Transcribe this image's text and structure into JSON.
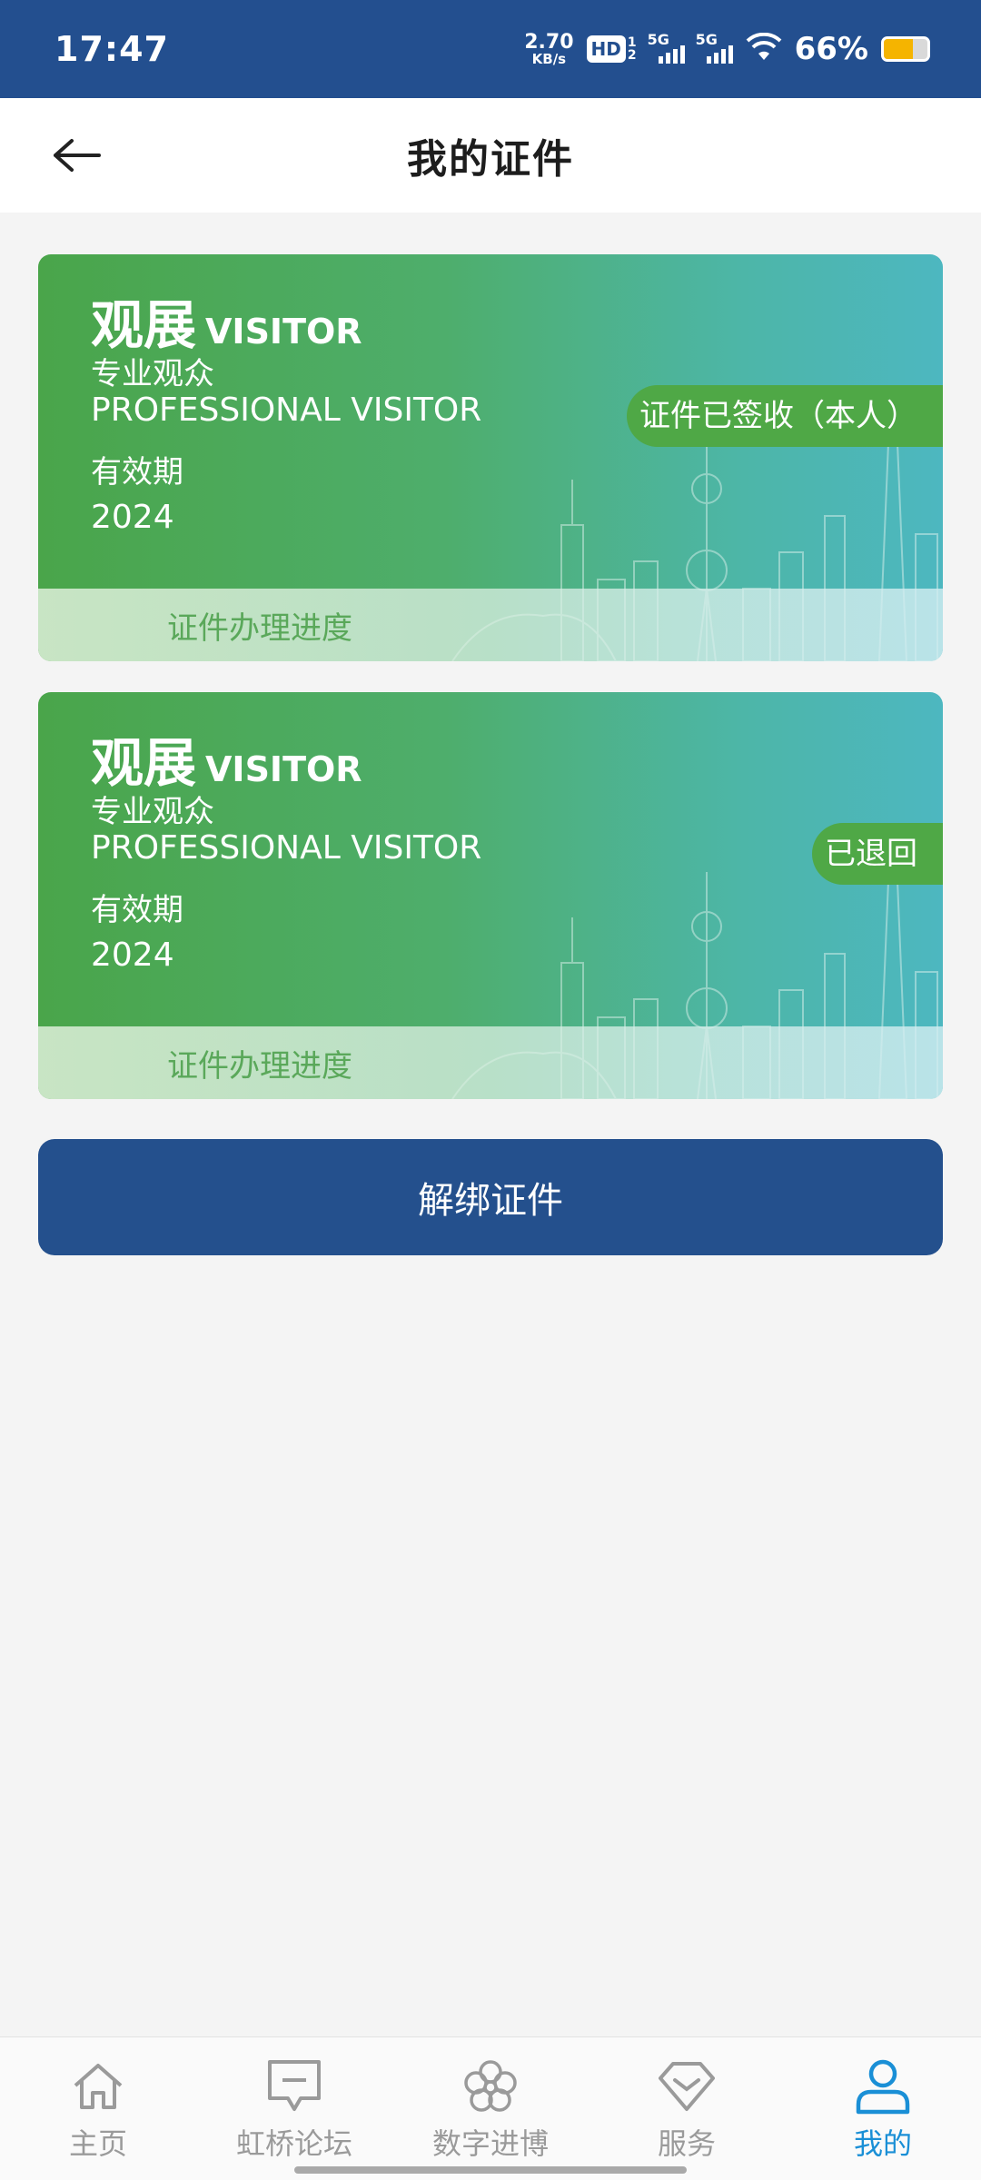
{
  "status_bar": {
    "time": "17:47",
    "net_speed_value": "2.70",
    "net_speed_unit": "KB/s",
    "hd_label": "HD",
    "hd_sub_top": "1",
    "hd_sub_bottom": "2",
    "sim1_label": "5G",
    "sim2_label": "5G",
    "battery_percent": "66%",
    "battery_level": 0.66,
    "battery_color": "#f5b400"
  },
  "header": {
    "title": "我的证件",
    "back_icon": "arrow-left-icon"
  },
  "cards": [
    {
      "type_cn": "观展",
      "type_en": "VISITOR",
      "sub_cn": "专业观众",
      "sub_en": "PROFESSIONAL VISITOR",
      "valid_label": "有效期",
      "valid_year": "2024",
      "status": "证件已签收（本人）",
      "progress_label": "证件办理进度"
    },
    {
      "type_cn": "观展",
      "type_en": "VISITOR",
      "sub_cn": "专业观众",
      "sub_en": "PROFESSIONAL VISITOR",
      "valid_label": "有效期",
      "valid_year": "2024",
      "status": "已退回",
      "progress_label": "证件办理进度"
    }
  ],
  "unbind_button": "解绑证件",
  "bottom_nav": {
    "items": [
      {
        "label": "主页",
        "icon": "home-icon"
      },
      {
        "label": "虹桥论坛",
        "icon": "message-icon"
      },
      {
        "label": "数字进博",
        "icon": "flower-icon"
      },
      {
        "label": "服务",
        "icon": "diamond-icon"
      },
      {
        "label": "我的",
        "icon": "user-icon"
      }
    ],
    "active_index": 4,
    "active_color": "#1a8fd6"
  },
  "colors": {
    "status_bar_bg": "#234f8f",
    "primary_button": "#24508d",
    "card_gradient_start": "#4aa54a",
    "card_gradient_end": "#4db7c0",
    "badge_green": "#4fa846"
  }
}
